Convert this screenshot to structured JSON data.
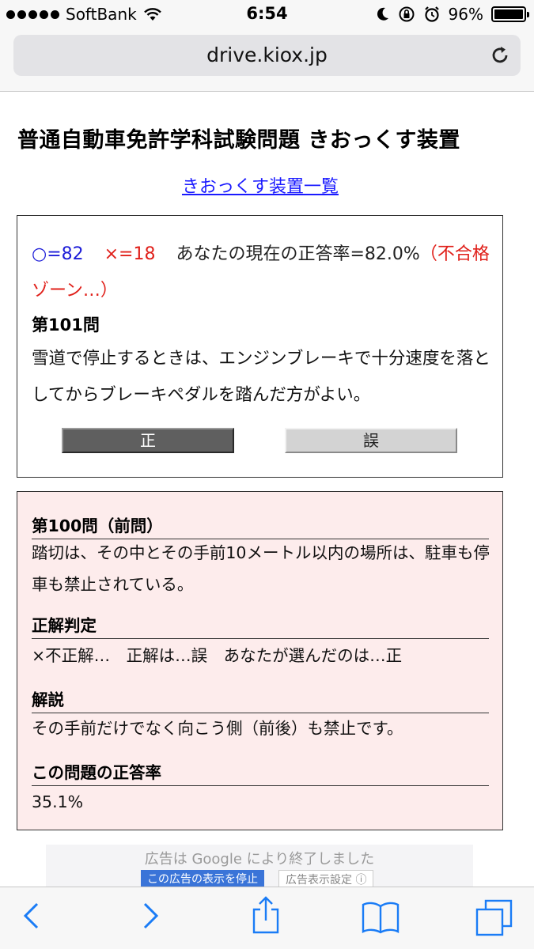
{
  "status_bar": {
    "carrier": "SoftBank",
    "time": "6:54",
    "battery": "96%",
    "battery_level": 0.96
  },
  "address_bar": {
    "url": "drive.kiox.jp"
  },
  "page": {
    "title": "普通自動車免許学科試験問題 きおっくす装置",
    "nav_link": "きおっくす装置一覧"
  },
  "question": {
    "correct_count": "○=82",
    "wrong_count": "×=18",
    "rate_text": "あなたの現在の正答率=82.0%",
    "zone_text": "（不合格ゾーン…）",
    "number": "第101問",
    "text": "雪道で停止するときは、エンジンブレーキで十分速度を落としてからブレーキペダルを踏んだ方がよい。",
    "true_button": "正",
    "false_button": "誤"
  },
  "previous": {
    "heading": "第100問（前問）",
    "text": "踏切は、その中とその手前10メートル以内の場所は、駐車も停車も禁止されている。",
    "judgment_heading": "正解判定",
    "judgment_text": "×不正解…　正解は…誤　あなたが選んだのは…正",
    "explanation_heading": "解説",
    "explanation_text": "その手前だけでなく向こう側（前後）も禁止です。",
    "rate_heading": "この問題の正答率",
    "rate_value": "35.1%"
  },
  "ad": {
    "ended_text": "広告は Google により終了しました",
    "stop_button": "この広告の表示を停止",
    "settings_button": "広告表示設定 ⓘ"
  },
  "toolbar": {
    "icons": [
      "back-icon",
      "forward-icon",
      "share-icon",
      "bookmarks-icon",
      "tabs-icon"
    ]
  },
  "colors": {
    "link": "#1a1aff",
    "correct": "#1c1cd8",
    "wrong": "#e0201a",
    "result_bg": "#fdecec",
    "ios_blue": "#1a7cf6"
  }
}
